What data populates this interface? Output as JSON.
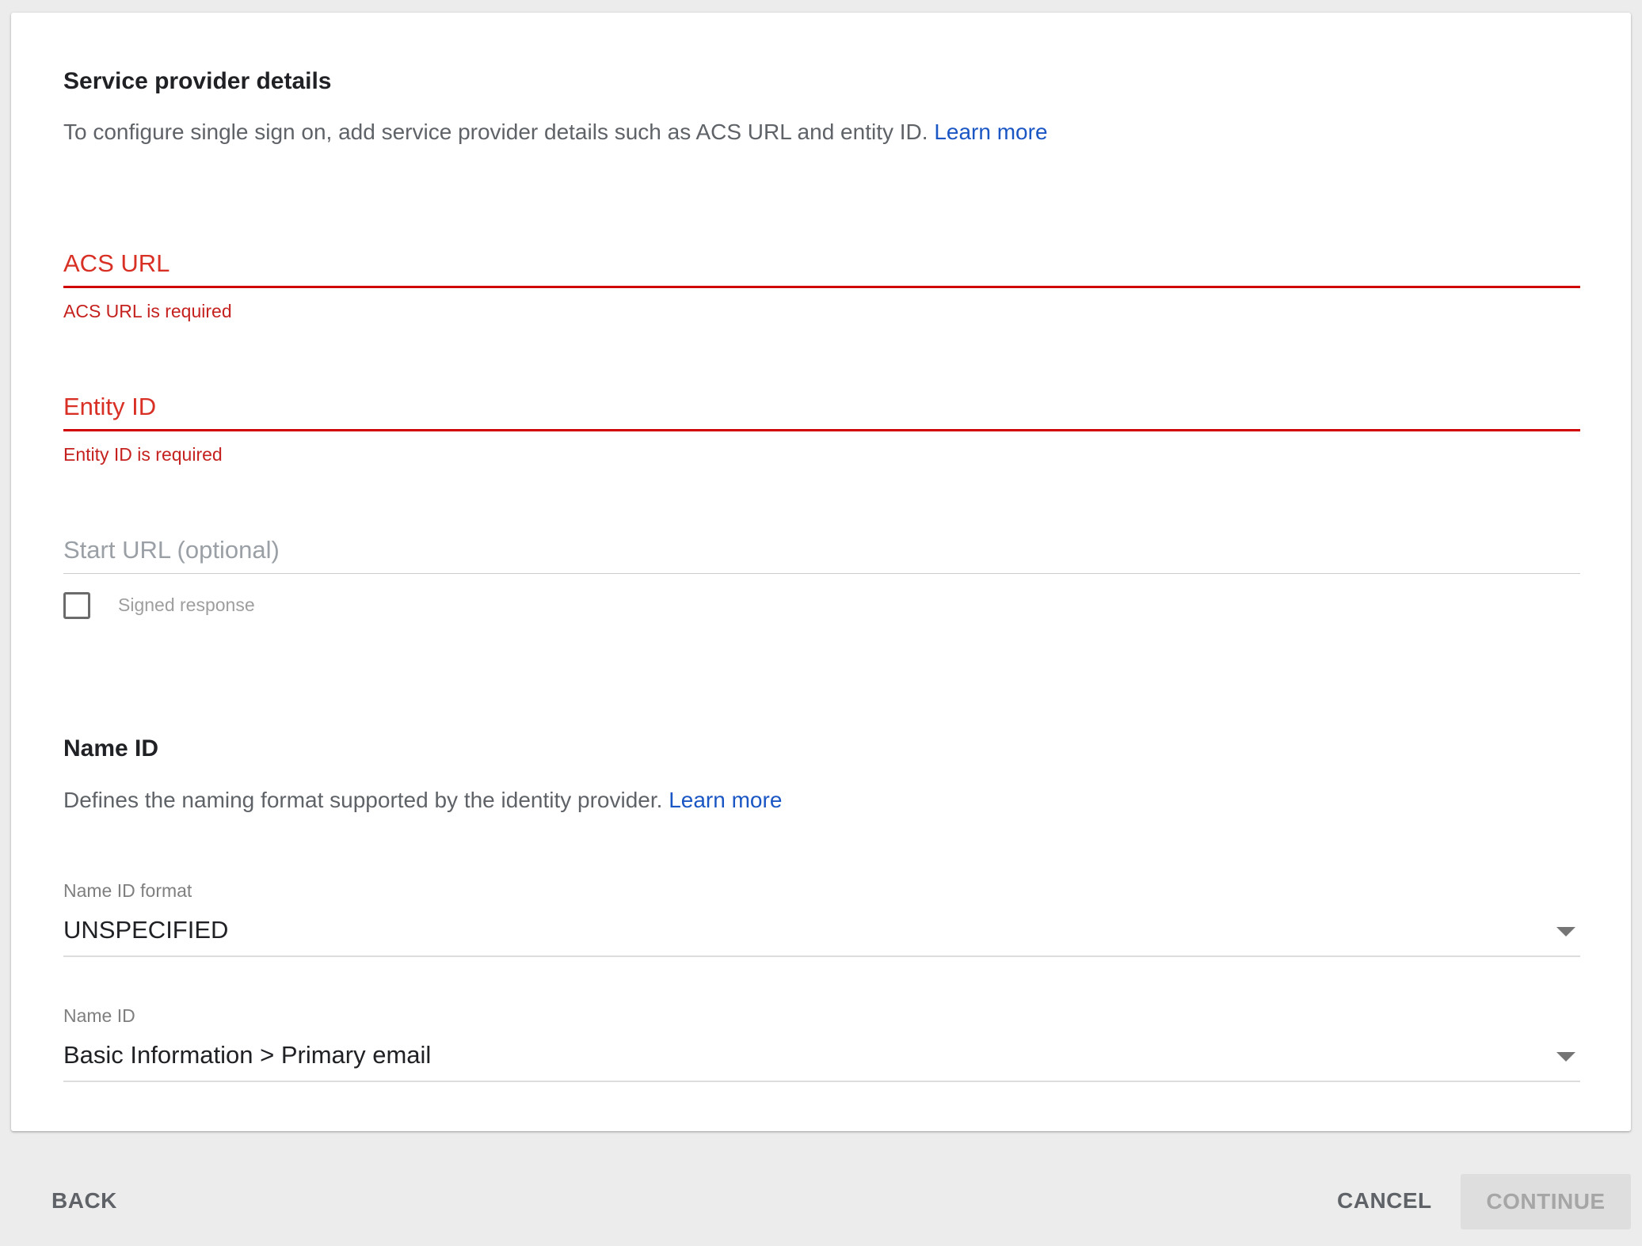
{
  "service_provider": {
    "title": "Service provider details",
    "description": "To configure single sign on, add service provider details such as ACS URL and entity ID.",
    "learn_more": "Learn more",
    "acs_url": {
      "placeholder": "ACS URL",
      "error": "ACS URL is required"
    },
    "entity_id": {
      "placeholder": "Entity ID",
      "error": "Entity ID is required"
    },
    "start_url": {
      "placeholder": "Start URL (optional)"
    },
    "signed_response": {
      "label": "Signed response",
      "checked": false
    }
  },
  "name_id_section": {
    "title": "Name ID",
    "description": "Defines the naming format supported by the identity provider.",
    "learn_more": "Learn more",
    "format_select": {
      "label": "Name ID format",
      "value": "UNSPECIFIED"
    },
    "name_id_select": {
      "label": "Name ID",
      "value": "Basic Information > Primary email"
    }
  },
  "footer": {
    "back": "BACK",
    "cancel": "CANCEL",
    "continue": "CONTINUE"
  },
  "colors": {
    "error": "#d93025",
    "link": "#1a56c4",
    "background": "#ececec",
    "card": "#ffffff"
  }
}
